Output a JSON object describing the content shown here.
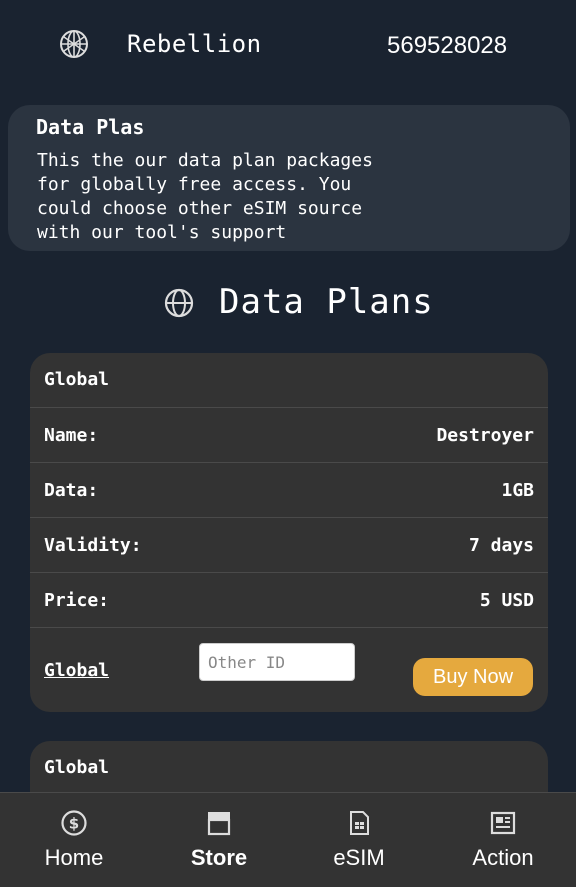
{
  "header": {
    "logo_icon": "globe-grid-logo-icon",
    "app_name": "Rebellion",
    "account_number": "569528028"
  },
  "info": {
    "title": "Data Plas",
    "text": "This the our data plan packages\nfor globally free access. You\ncould choose other eSIM source\nwith our tool's support"
  },
  "section": {
    "icon": "globe-icon",
    "title": "Data Plans"
  },
  "plans": [
    {
      "region": "Global",
      "rows": [
        {
          "label": "Name:",
          "value": "Destroyer"
        },
        {
          "label": "Data:",
          "value": "1GB"
        },
        {
          "label": "Validity:",
          "value": "7 days"
        },
        {
          "label": "Price:",
          "value": "5 USD"
        }
      ],
      "link": "Global",
      "input_placeholder": "Other ID",
      "buy_label": "Buy Now"
    },
    {
      "region": "Global"
    }
  ],
  "tabbar": {
    "items": [
      {
        "label": "Home",
        "icon": "dollar-circle-icon",
        "active": false
      },
      {
        "label": "Store",
        "icon": "store-icon",
        "active": true
      },
      {
        "label": "eSIM",
        "icon": "sim-card-icon",
        "active": false
      },
      {
        "label": "Action",
        "icon": "news-icon",
        "active": false
      }
    ]
  },
  "colors": {
    "background": "#1a2330",
    "card": "#333333",
    "info_card": "#2b3440",
    "accent": "#e5a93e"
  }
}
